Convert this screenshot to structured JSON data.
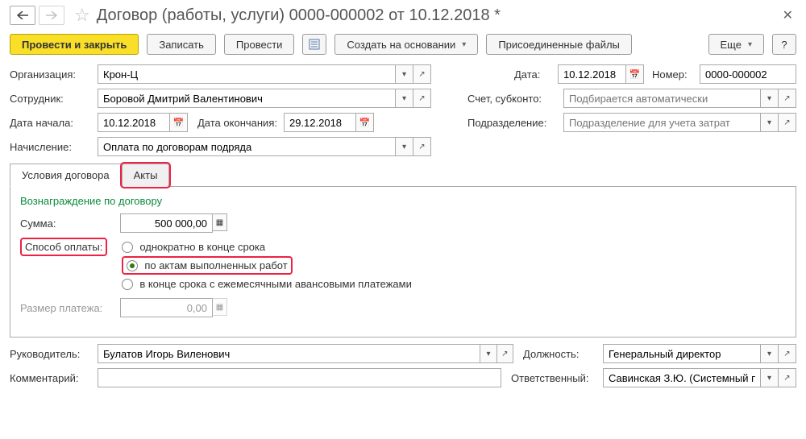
{
  "header": {
    "title": "Договор (работы, услуги) 0000-000002 от 10.12.2018 *"
  },
  "toolbar": {
    "post_close": "Провести и закрыть",
    "save": "Записать",
    "post": "Провести",
    "create_based": "Создать на основании",
    "attachments": "Присоединенные файлы",
    "more": "Еще",
    "help": "?"
  },
  "fields": {
    "organization_label": "Организация:",
    "organization_value": "Крон-Ц",
    "date_label": "Дата:",
    "date_value": "10.12.2018",
    "number_label": "Номер:",
    "number_value": "0000-000002",
    "employee_label": "Сотрудник:",
    "employee_value": "Боровой Дмитрий Валентинович",
    "account_label": "Счет, субконто:",
    "account_placeholder": "Подбирается автоматически",
    "start_label": "Дата начала:",
    "start_value": "10.12.2018",
    "end_label": "Дата окончания:",
    "end_value": "29.12.2018",
    "division_label": "Подразделение:",
    "division_placeholder": "Подразделение для учета затрат",
    "accrual_label": "Начисление:",
    "accrual_value": "Оплата по договорам подряда"
  },
  "tabs": {
    "conditions": "Условия договора",
    "acts": "Акты"
  },
  "panel": {
    "section": "Вознаграждение по договору",
    "sum_label": "Сумма:",
    "sum_value": "500 000,00",
    "payment_method_label": "Способ оплаты:",
    "opt_once": "однократно в конце срока",
    "opt_acts": "по актам выполненных работ",
    "opt_monthly": "в конце срока с ежемесячными авансовыми платежами",
    "payment_size_label": "Размер платежа:",
    "payment_size_value": "0,00"
  },
  "footer": {
    "leader_label": "Руководитель:",
    "leader_value": "Булатов Игорь Виленович",
    "position_label": "Должность:",
    "position_value": "Генеральный директор",
    "comment_label": "Комментарий:",
    "responsible_label": "Ответственный:",
    "responsible_value": "Савинская З.Ю. (Системный прог"
  }
}
